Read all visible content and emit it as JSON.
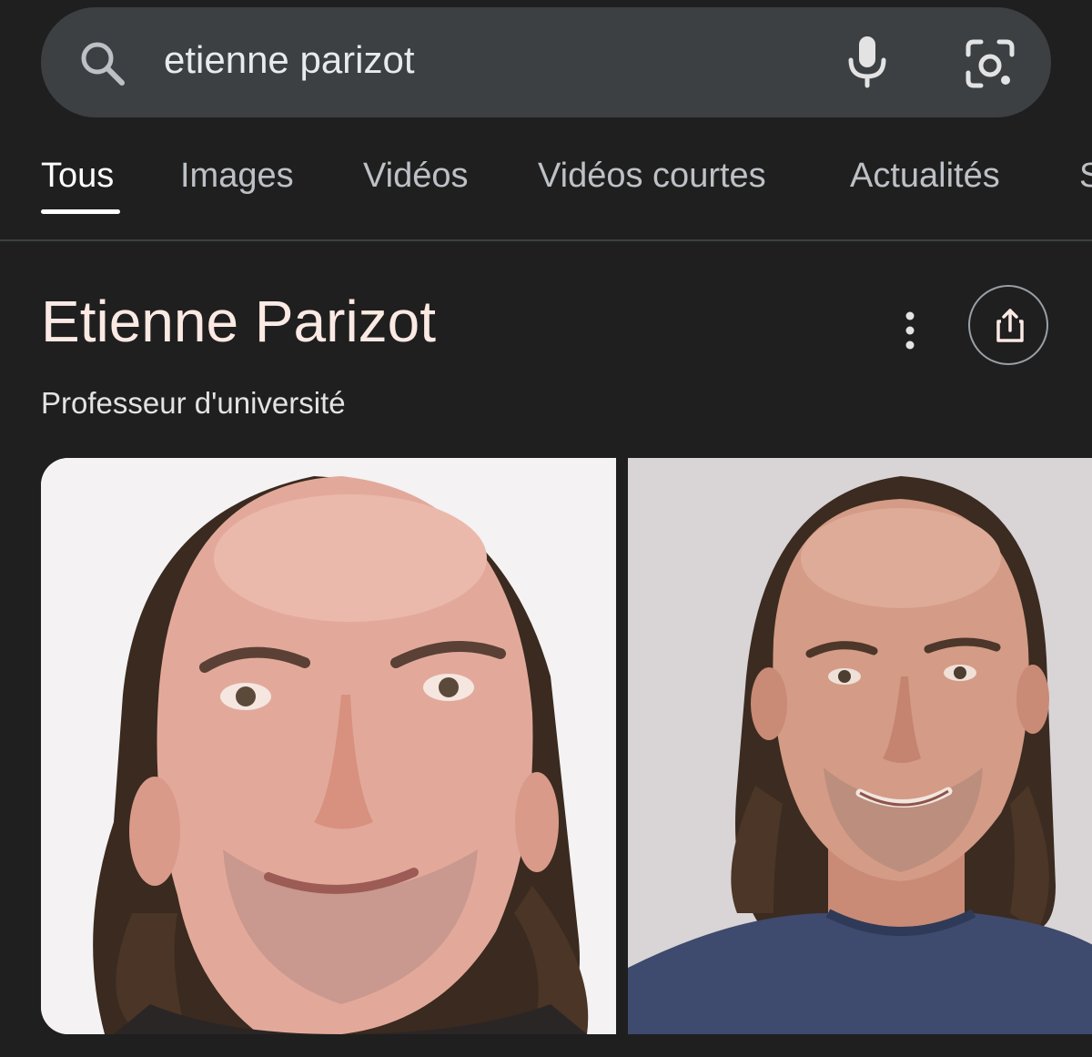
{
  "search": {
    "query": "etienne parizot"
  },
  "tabs": [
    {
      "label": "Tous",
      "active": true
    },
    {
      "label": "Images",
      "active": false
    },
    {
      "label": "Vidéos",
      "active": false
    },
    {
      "label": "Vidéos courtes",
      "active": false
    },
    {
      "label": "Actualités",
      "active": false
    },
    {
      "label": "S",
      "active": false
    }
  ],
  "knowledge_panel": {
    "title": "Etienne Parizot",
    "subtitle": "Professeur d'université",
    "icons": {
      "more": "more-vert-icon",
      "share": "share-icon"
    }
  },
  "icons": {
    "search": "search-icon",
    "mic": "mic-icon",
    "lens": "google-lens-icon"
  },
  "colors": {
    "background": "#1f1f1f",
    "search_bar": "#3c4043",
    "title": "#fbe9e4",
    "tab_inactive": "#bdc1c6",
    "tab_active": "#ffffff"
  }
}
